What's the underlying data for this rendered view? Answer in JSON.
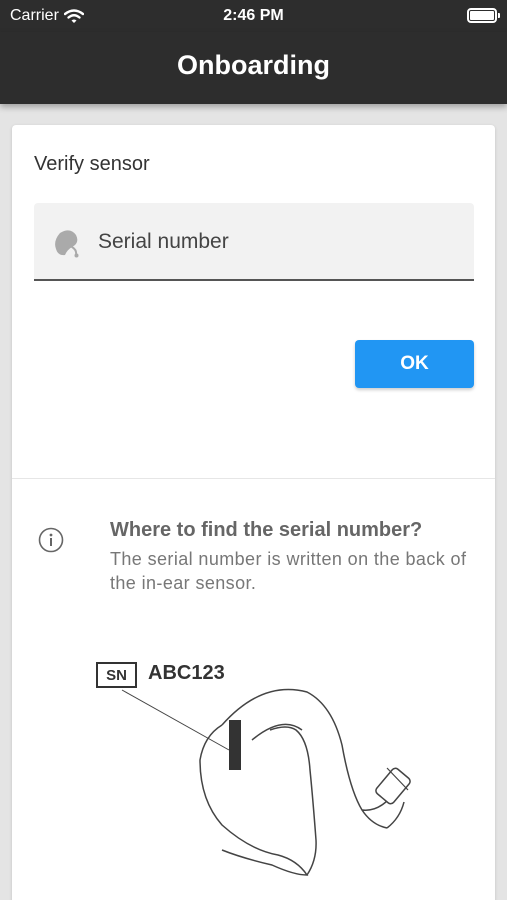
{
  "status_bar": {
    "carrier": "Carrier",
    "time": "2:46 PM"
  },
  "app_bar": {
    "title": "Onboarding"
  },
  "card": {
    "title": "Verify sensor",
    "serial_field": {
      "label": "Serial number",
      "icon": "hearing-sensor-icon"
    },
    "ok_button": "OK",
    "accent_color": "#2196f3"
  },
  "info": {
    "icon": "info-icon",
    "title": "Where to find the serial number?",
    "text": "The serial number is written on the back of the in-ear sensor."
  },
  "illustration": {
    "sn_label": "SN",
    "sn_value": "ABC123"
  }
}
